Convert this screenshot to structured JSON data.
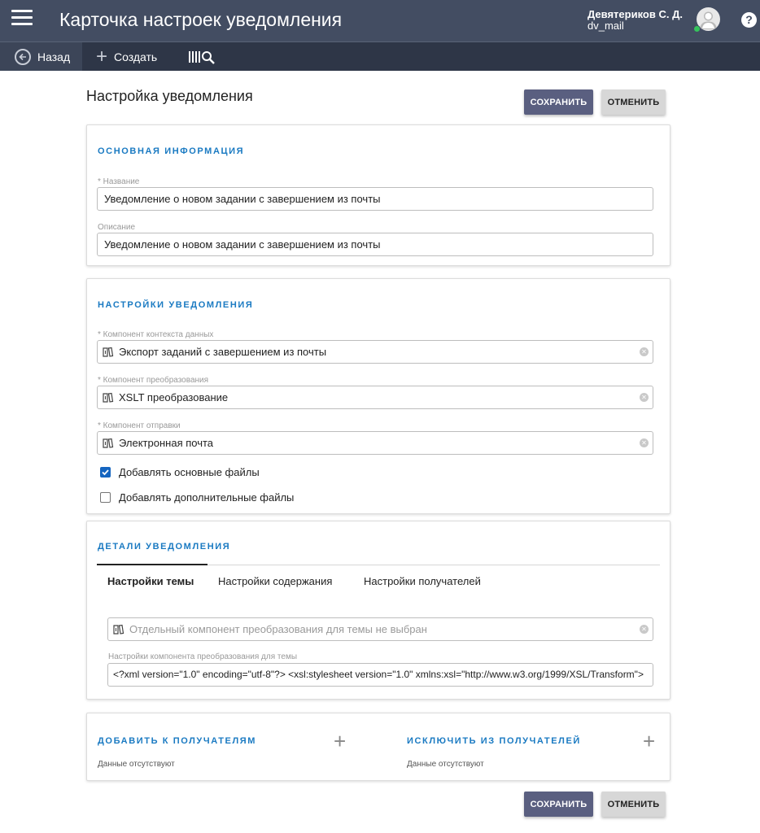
{
  "header": {
    "title": "Карточка настроек уведомления",
    "user_name": "Девятериков С. Д.",
    "user_login": "dv_mail",
    "help_label": "?"
  },
  "toolbar": {
    "back_label": "Назад",
    "create_label": "Создать"
  },
  "page": {
    "title": "Настройка уведомления",
    "save_label": "СОХРАНИТЬ",
    "cancel_label": "ОТМЕНИТЬ"
  },
  "basic_info": {
    "section_title": "ОСНОВНАЯ ИНФОРМАЦИЯ",
    "name_label": "* Название",
    "name_value": "Уведомление о новом задании с завершением из почты",
    "description_label": "Описание",
    "description_value": "Уведомление о новом задании с завершением из почты"
  },
  "notification_settings": {
    "section_title": "НАСТРОЙКИ УВЕДОМЛЕНИЯ",
    "data_context_label": "* Компонент контекста данных",
    "data_context_value": "Экспорт заданий с завершением из почты",
    "transform_label": "* Компонент преобразования",
    "transform_value": "XSLT преобразование",
    "send_label": "* Компонент отправки",
    "send_value": "Электронная почта",
    "add_main_files_label": "Добавлять основные файлы",
    "add_main_files_checked": true,
    "add_extra_files_label": "Добавлять дополнительные файлы",
    "add_extra_files_checked": false
  },
  "details": {
    "section_title": "ДЕТАЛИ УВЕДОМЛЕНИЯ",
    "tabs": [
      {
        "label": "Настройки темы",
        "active": true
      },
      {
        "label": "Настройки содержания",
        "active": false
      },
      {
        "label": "Настройки получателей",
        "active": false
      }
    ],
    "subject_component_placeholder": "Отдельный компонент преобразования для темы не выбран",
    "subject_settings_label": "Настройки компонента преобразования для темы",
    "subject_settings_value": "<?xml version=\"1.0\" encoding=\"utf-8\"?> <xsl:stylesheet version=\"1.0\" xmlns:xsl=\"http://www.w3.org/1999/XSL/Transform\">"
  },
  "recipients": {
    "add_title": "ДОБАВИТЬ К ПОЛУЧАТЕЛЯМ",
    "add_empty": "Данные отсутствуют",
    "exclude_title": "ИСКЛЮЧИТЬ ИЗ ПОЛУЧАТЕЛЕЙ",
    "exclude_empty": "Данные отсутствуют"
  },
  "colors": {
    "header_bg": "#434d62",
    "toolbar_bg": "#2e3647",
    "section_title": "#1a7ac2",
    "primary_button": "#5a5f80",
    "checkbox": "#1565c0",
    "online_status": "#35c45c"
  },
  "icons": {
    "menu": "hamburger-icon",
    "back": "arrow-left-circle-icon",
    "create": "plus-icon",
    "search": "library-search-icon",
    "avatar": "user-avatar-icon",
    "help": "question-icon",
    "lookup": "book-lookup-icon",
    "clear": "clear-x-icon",
    "add": "plus-icon"
  }
}
